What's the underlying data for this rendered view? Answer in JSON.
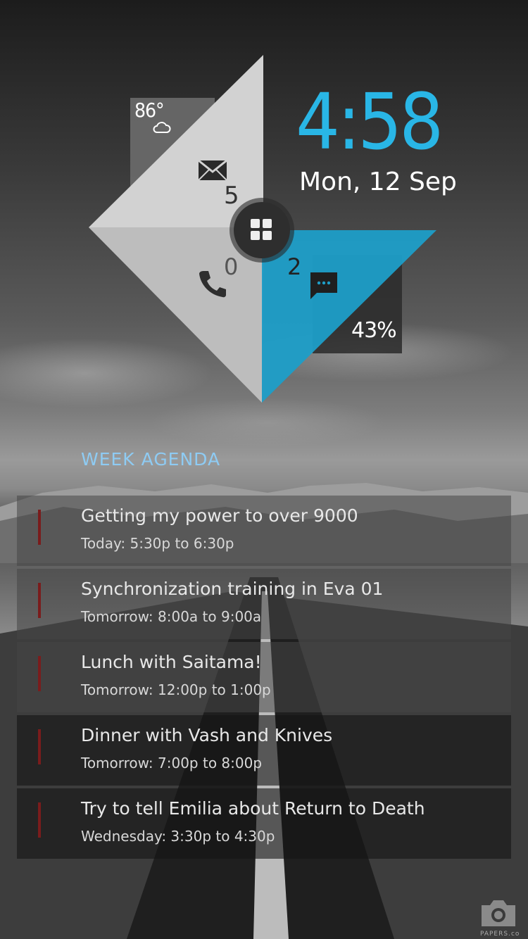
{
  "weather": {
    "temperature": "86°",
    "icon": "cloud-icon"
  },
  "notifications": {
    "mail_count": "5",
    "missed_calls": "0",
    "messages": "2",
    "battery": "43%"
  },
  "clock": {
    "time": "4:58",
    "date": "Mon, 12 Sep"
  },
  "agenda": {
    "title": "WEEK AGENDA",
    "events": [
      {
        "title": "Getting my power to over 9000",
        "time": "Today: 5:30p to 6:30p"
      },
      {
        "title": "Synchronization training in Eva 01",
        "time": "Tomorrow: 8:00a to 9:00a"
      },
      {
        "title": "Lunch with Saitama!",
        "time": "Tomorrow: 12:00p to 1:00p"
      },
      {
        "title": "Dinner with Vash and Knives",
        "time": "Tomorrow: 7:00p to 8:00p"
      },
      {
        "title": "Try to tell Emilia about Return to Death",
        "time": "Wednesday: 3:30p to 4:30p"
      }
    ]
  },
  "watermark": "PAPERS.co",
  "colors": {
    "accent": "#29b6e6",
    "agenda_title": "#8ecbf3",
    "event_bar": "#7a1c1c"
  }
}
